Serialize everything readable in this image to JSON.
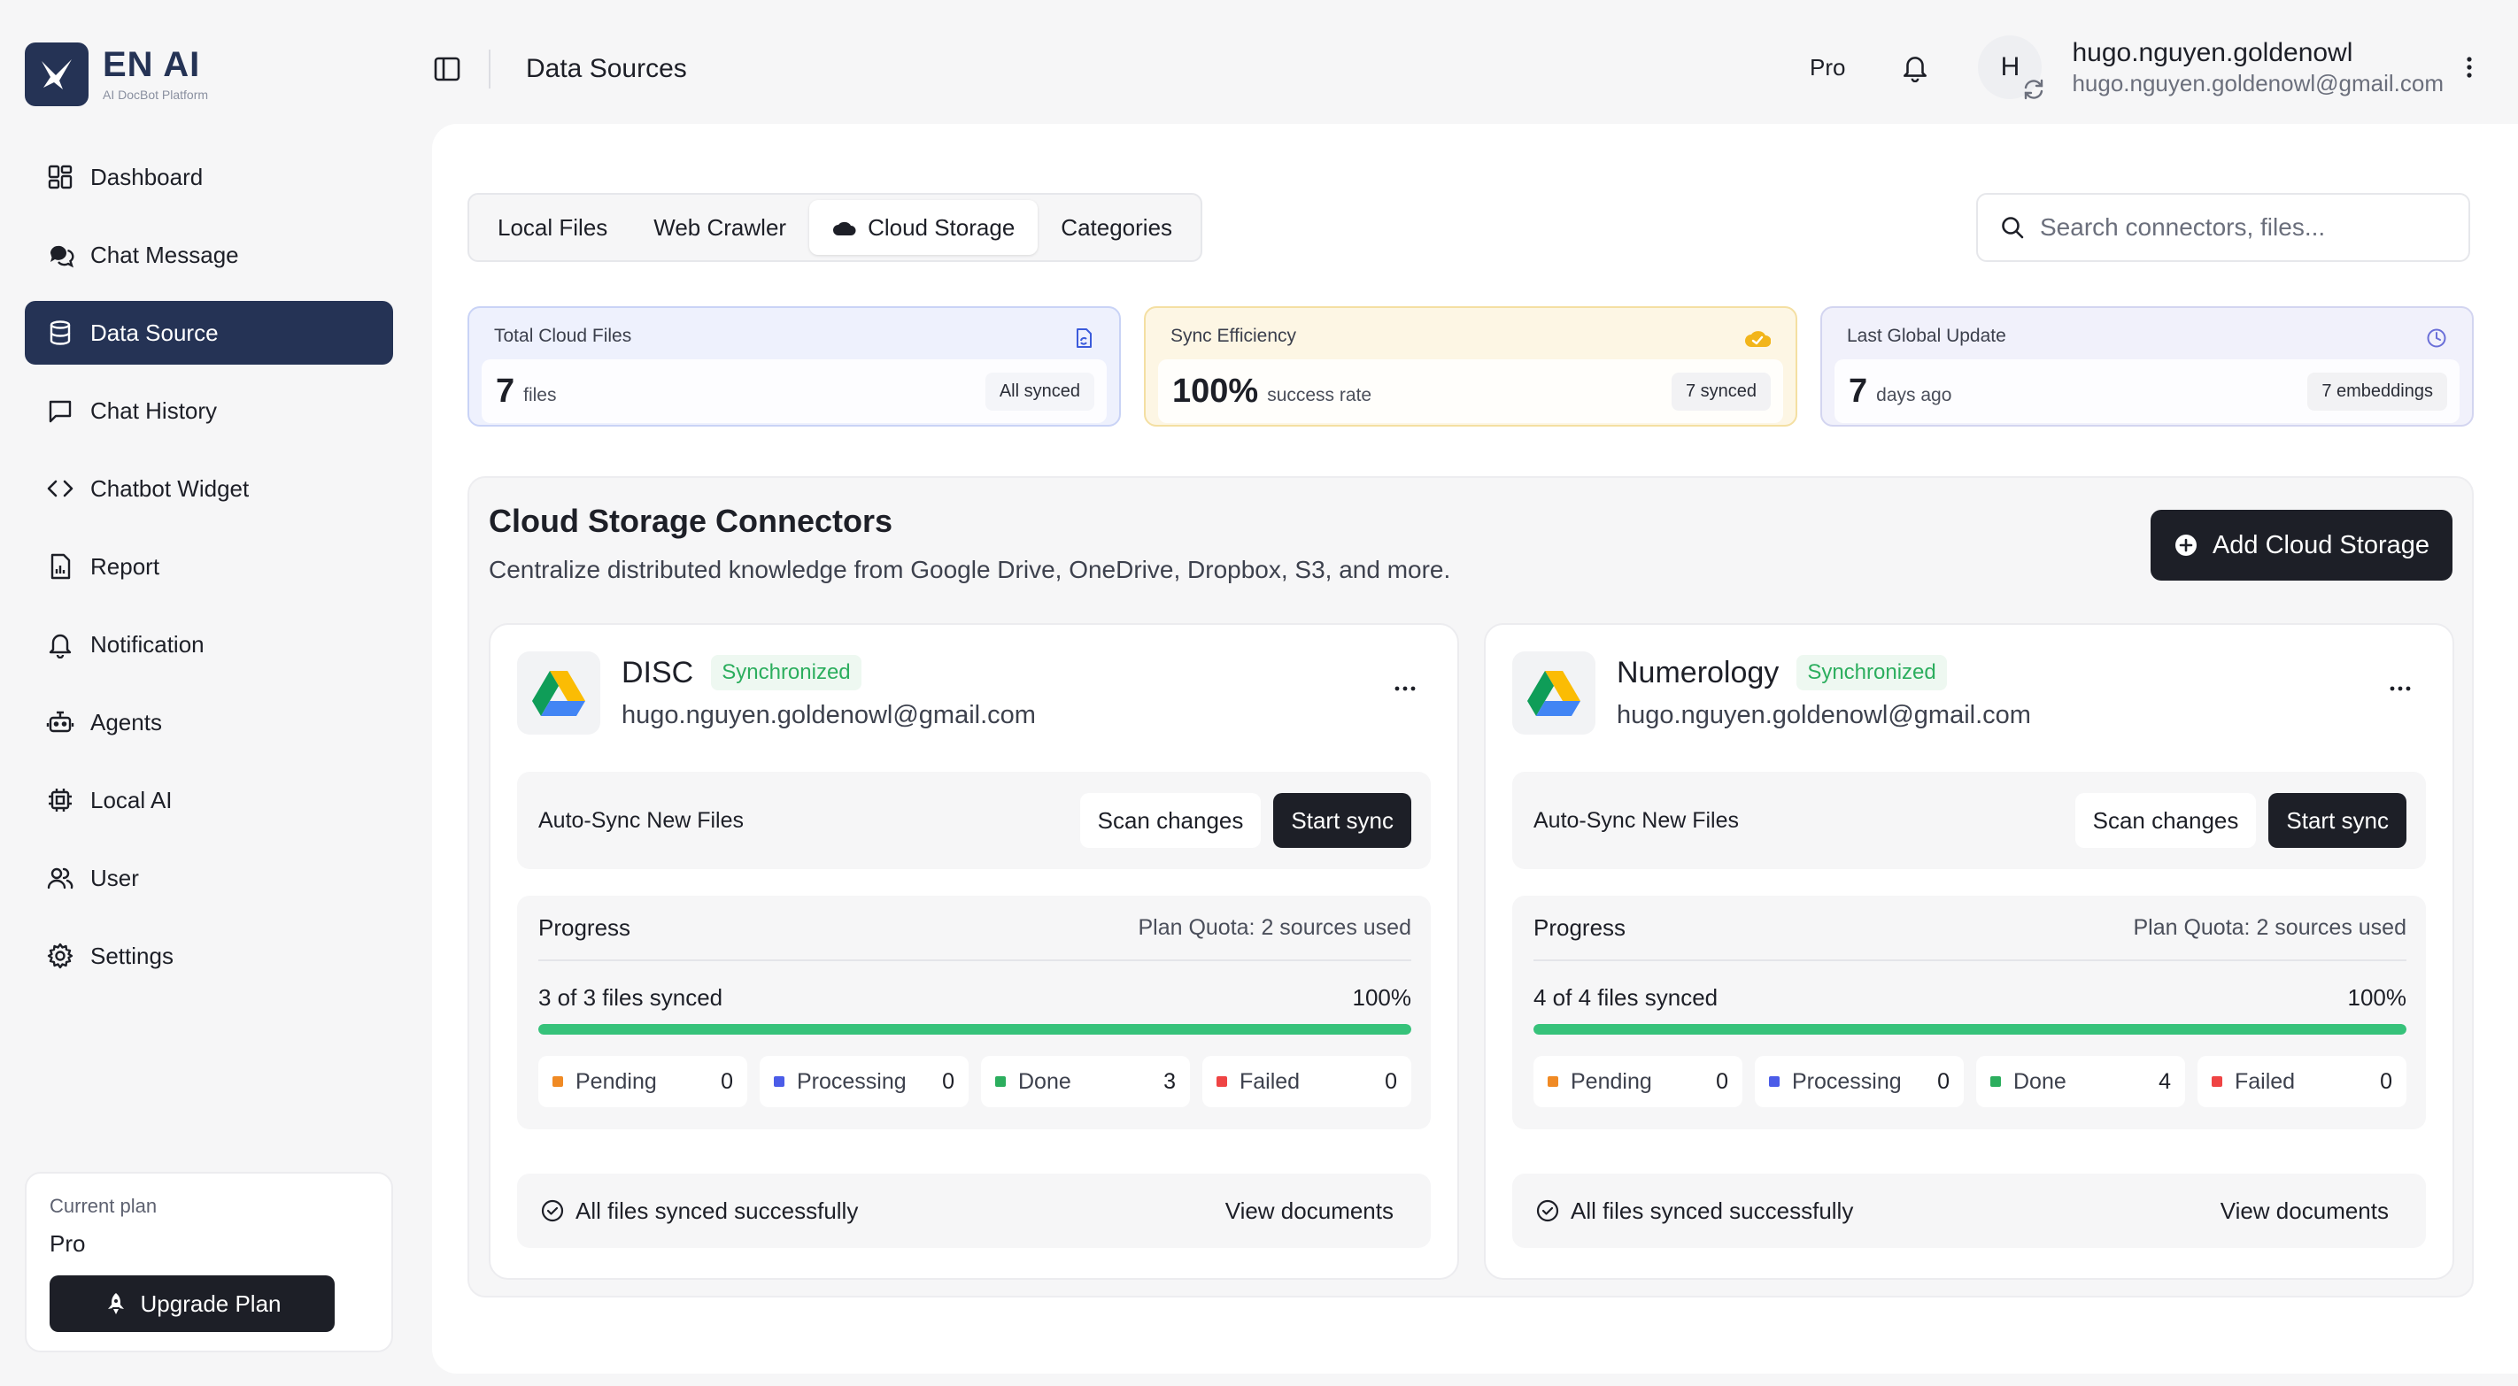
{
  "brand": {
    "name": "EN AI",
    "tagline": "AI DocBot Platform",
    "color": "#253355"
  },
  "sidebar": {
    "items": [
      {
        "label": "Dashboard",
        "icon": "dashboard-icon"
      },
      {
        "label": "Chat Message",
        "icon": "chat-message-icon"
      },
      {
        "label": "Data Source",
        "icon": "database-icon",
        "active": true
      },
      {
        "label": "Chat History",
        "icon": "chat-history-icon"
      },
      {
        "label": "Chatbot Widget",
        "icon": "code-icon"
      },
      {
        "label": "Report",
        "icon": "report-icon"
      },
      {
        "label": "Notification",
        "icon": "bell-icon"
      },
      {
        "label": "Agents",
        "icon": "bot-icon"
      },
      {
        "label": "Local AI",
        "icon": "chip-icon"
      },
      {
        "label": "User",
        "icon": "users-icon"
      },
      {
        "label": "Settings",
        "icon": "gear-icon"
      }
    ],
    "plan": {
      "label": "Current plan",
      "value": "Pro",
      "upgrade_label": "Upgrade Plan"
    }
  },
  "header": {
    "title": "Data Sources",
    "plan_badge": "Pro",
    "user": {
      "initial": "H",
      "name": "hugo.nguyen.goldenowl",
      "email": "hugo.nguyen.goldenowl@gmail.com"
    }
  },
  "tabs": [
    {
      "label": "Local Files"
    },
    {
      "label": "Web Crawler"
    },
    {
      "label": "Cloud Storage",
      "active": true
    },
    {
      "label": "Categories"
    }
  ],
  "search": {
    "placeholder": "Search connectors, files..."
  },
  "stats": [
    {
      "label": "Total Cloud Files",
      "value": "7",
      "unit": "files",
      "badge": "All synced",
      "icon": "file-sync-icon",
      "color": "#3b5bdb"
    },
    {
      "label": "Sync Efficiency",
      "value": "100%",
      "unit": "success rate",
      "badge": "7 synced",
      "icon": "cloud-check-icon",
      "color": "#f2b51b"
    },
    {
      "label": "Last Global Update",
      "value": "7",
      "unit": "days ago",
      "badge": "7 embeddings",
      "icon": "clock-icon",
      "color": "#6a6fd8"
    }
  ],
  "connectors": {
    "title": "Cloud Storage Connectors",
    "description": "Centralize distributed knowledge from Google Drive, OneDrive, Dropbox, S3, and more.",
    "add_label": "Add Cloud Storage",
    "cards": [
      {
        "name": "DISC",
        "status": "Synchronized",
        "email": "hugo.nguyen.goldenowl@gmail.com",
        "auto_sync_label": "Auto-Sync New Files",
        "scan_label": "Scan changes",
        "start_label": "Start sync",
        "progress_title": "Progress",
        "quota": "Plan Quota: 2 sources used",
        "files_synced": "3 of 3 files synced",
        "percent": "100%",
        "progress_fraction": 1.0,
        "counts": [
          {
            "label": "Pending",
            "value": "0",
            "color": "#f08a24"
          },
          {
            "label": "Processing",
            "value": "0",
            "color": "#4b5ce8"
          },
          {
            "label": "Done",
            "value": "3",
            "color": "#2cae5e"
          },
          {
            "label": "Failed",
            "value": "0",
            "color": "#ef4444"
          }
        ],
        "footer": "All files synced successfully",
        "view_label": "View documents"
      },
      {
        "name": "Numerology",
        "status": "Synchronized",
        "email": "hugo.nguyen.goldenowl@gmail.com",
        "auto_sync_label": "Auto-Sync New Files",
        "scan_label": "Scan changes",
        "start_label": "Start sync",
        "progress_title": "Progress",
        "quota": "Plan Quota: 2 sources used",
        "files_synced": "4 of 4 files synced",
        "percent": "100%",
        "progress_fraction": 1.0,
        "counts": [
          {
            "label": "Pending",
            "value": "0",
            "color": "#f08a24"
          },
          {
            "label": "Processing",
            "value": "0",
            "color": "#4b5ce8"
          },
          {
            "label": "Done",
            "value": "4",
            "color": "#2cae5e"
          },
          {
            "label": "Failed",
            "value": "0",
            "color": "#ef4444"
          }
        ],
        "footer": "All files synced successfully",
        "view_label": "View documents"
      }
    ]
  }
}
